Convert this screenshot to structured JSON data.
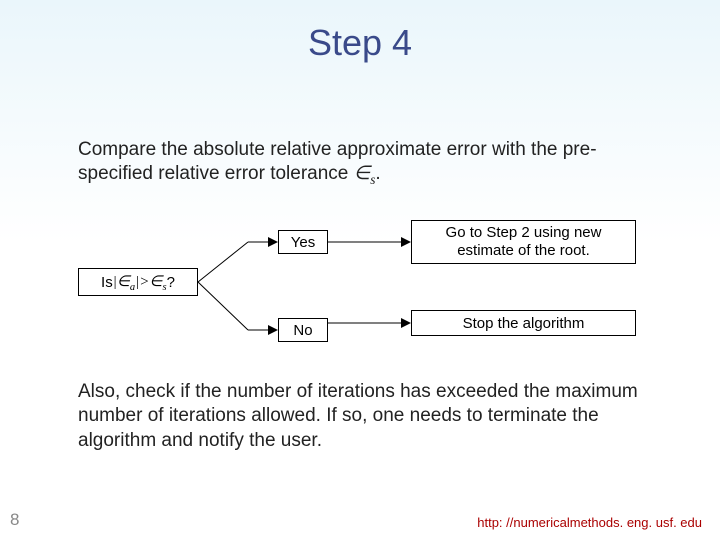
{
  "title": "Step 4",
  "para1": {
    "pre": "Compare the absolute relative approximate error with the pre-specified relative error tolerance ",
    "tol_symbol": "∈",
    "tol_sub": "s",
    "post": "."
  },
  "flow": {
    "decision_pre": "Is ",
    "decision_expr_bar1": "|",
    "decision_expr_ea_sym": "∈",
    "decision_expr_ea_sub": "a",
    "decision_expr_bar2": "|",
    "decision_expr_gt": ">",
    "decision_expr_es_sym": "∈",
    "decision_expr_es_sub": "s",
    "decision_post": " ?",
    "yes_label": "Yes",
    "no_label": "No",
    "yes_outcome": "Go to Step 2 using new estimate of the root.",
    "no_outcome": "Stop the algorithm"
  },
  "para2": "Also, check if the number of iterations has exceeded the maximum number of iterations allowed. If so, one needs to terminate the algorithm and notify the user.",
  "page_number": "8",
  "footer_url": "http: //numericalmethods. eng. usf. edu"
}
